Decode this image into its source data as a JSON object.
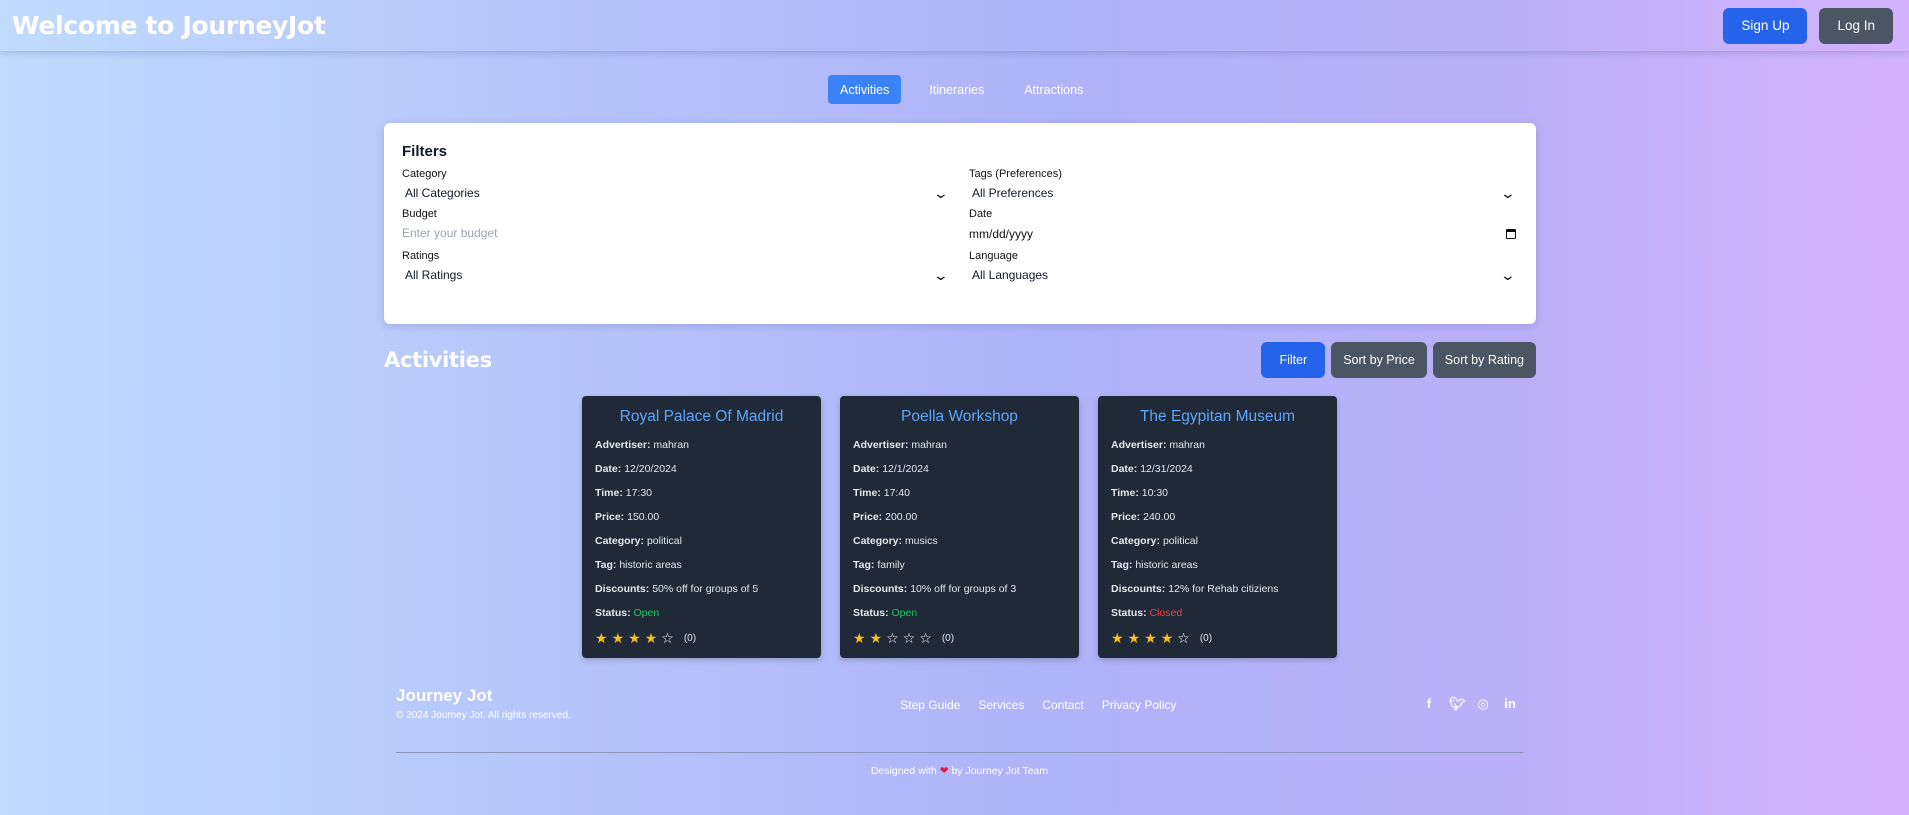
{
  "header": {
    "title": "Welcome to JourneyJot",
    "signup_label": "Sign Up",
    "login_label": "Log In"
  },
  "tabs": [
    {
      "label": "Activities",
      "active": true
    },
    {
      "label": "Itineraries",
      "active": false
    },
    {
      "label": "Attractions",
      "active": false
    }
  ],
  "filters": {
    "title": "Filters",
    "category": {
      "label": "Category",
      "value": "All Categories"
    },
    "tags": {
      "label": "Tags (Preferences)",
      "value": "All Preferences"
    },
    "budget": {
      "label": "Budget",
      "placeholder": "Enter your budget"
    },
    "date": {
      "label": "Date",
      "placeholder": "mm/dd/yyyy"
    },
    "ratings": {
      "label": "Ratings",
      "value": "All Ratings"
    },
    "language": {
      "label": "Language",
      "value": "All Languages"
    }
  },
  "section": {
    "title": "Activities",
    "filter_label": "Filter",
    "sort_price_label": "Sort by Price",
    "sort_rating_label": "Sort by Rating"
  },
  "field_labels": {
    "advertiser": "Advertiser:",
    "date": "Date:",
    "time": "Time:",
    "price": "Price:",
    "category": "Category:",
    "tag": "Tag:",
    "discounts": "Discounts:",
    "status": "Status:"
  },
  "cards": [
    {
      "title": "Royal Palace Of Madrid",
      "advertiser": "mahran",
      "date": "12/20/2024",
      "time": "17:30",
      "price": "150.00",
      "category": "political",
      "tag": "historic areas",
      "discounts": "50% off for groups of 5",
      "status": "Open",
      "rating": 4,
      "reviews": "(0)"
    },
    {
      "title": "Poella Workshop",
      "advertiser": "mahran",
      "date": "12/1/2024",
      "time": "17:40",
      "price": "200.00",
      "category": "musics",
      "tag": "family",
      "discounts": "10% off for groups of 3",
      "status": "Open",
      "rating": 2,
      "reviews": "(0)"
    },
    {
      "title": "The Egypitan Museum",
      "advertiser": "mahran",
      "date": "12/31/2024",
      "time": "10:30",
      "price": "240.00",
      "category": "political",
      "tag": "historic areas",
      "discounts": "12% for Rehab citiziens",
      "status": "Closed",
      "rating": 4,
      "reviews": "(0)"
    }
  ],
  "footer": {
    "brand": "Journey Jot",
    "copyright": "© 2024 Journey Jot. All rights reserved.",
    "links": [
      "Step Guide",
      "Services",
      "Contact",
      "Privacy Policy"
    ],
    "social_icons": [
      "facebook-icon",
      "twitter-icon",
      "instagram-icon",
      "linkedin-icon"
    ],
    "credit_prefix": "Designed with",
    "credit_suffix": "by Journey Jot Team"
  },
  "colors": {
    "primary": "#2563eb",
    "secondary": "#4b5563",
    "card_bg": "#1f2937",
    "card_title": "#60a5fa",
    "status_open": "#22c55e",
    "status_closed": "#ef4444",
    "star": "#fbbf24"
  }
}
